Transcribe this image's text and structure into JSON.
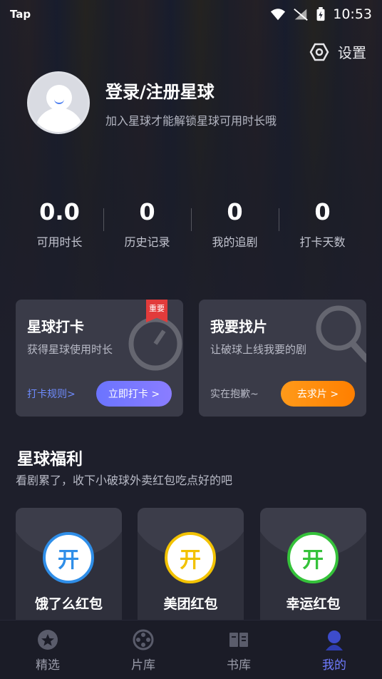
{
  "status_bar": {
    "carrier": "Tap",
    "time": "10:53"
  },
  "settings": {
    "label": "设置",
    "icon": "hexagon-settings-icon"
  },
  "profile": {
    "title": "登录/注册星球",
    "subtitle": "加入星球才能解锁星球可用时长哦",
    "avatar_icon": "default-avatar-icon"
  },
  "stats": [
    {
      "value": "0.0",
      "label": "可用时长"
    },
    {
      "value": "0",
      "label": "历史记录"
    },
    {
      "value": "0",
      "label": "我的追剧"
    },
    {
      "value": "0",
      "label": "打卡天数"
    }
  ],
  "checkin_card": {
    "badge": "重要",
    "title": "星球打卡",
    "subtitle": "获得星球使用时长",
    "link": "打卡规则>",
    "button": "立即打卡 >"
  },
  "request_card": {
    "title": "我要找片",
    "subtitle": "让破球上线我要的剧",
    "note": "实在抱歉~",
    "button": "去求片 >"
  },
  "welfare": {
    "title": "星球福利",
    "subtitle": "看剧累了，收下小破球外卖红包吃点好的吧",
    "items": [
      {
        "coin": "开",
        "label": "饿了么红包",
        "color": "#2f8ee8"
      },
      {
        "coin": "开",
        "label": "美团红包",
        "color": "#f2c200"
      },
      {
        "coin": "开",
        "label": "幸运红包",
        "color": "#35c23a"
      }
    ]
  },
  "tabbar": [
    {
      "label": "精选",
      "icon": "star-icon",
      "active": false
    },
    {
      "label": "片库",
      "icon": "film-reel-icon",
      "active": false
    },
    {
      "label": "书库",
      "icon": "book-icon",
      "active": false
    },
    {
      "label": "我的",
      "icon": "user-icon",
      "active": true
    }
  ],
  "colors": {
    "accent": "#6f7bff",
    "orange": "#ff8a0a",
    "background": "#1e1f2b"
  }
}
